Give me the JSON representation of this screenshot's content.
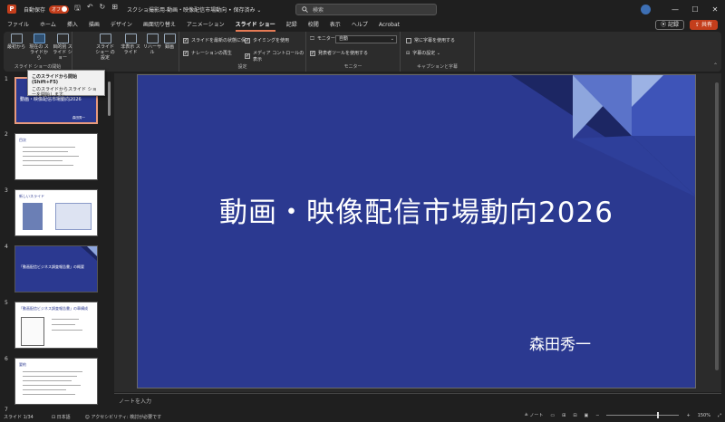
{
  "titlebar": {
    "logo": "P",
    "autosave_label": "自動保存",
    "autosave_state": "オフ",
    "doc_title": "スクショ撮影用-動画・映像配信市場動向 • 保存済み ⌄",
    "search_placeholder": "検索"
  },
  "tabs": [
    "ファイル",
    "ホーム",
    "挿入",
    "描画",
    "デザイン",
    "画面切り替え",
    "アニメーション",
    "スライド ショー",
    "記録",
    "校閲",
    "表示",
    "ヘルプ",
    "Acrobat"
  ],
  "active_tab": "スライド ショー",
  "ribbon_right": {
    "record_label": "記録",
    "share_label": "共有"
  },
  "ribbon": {
    "buttons": [
      "最初から",
      "現在の スライドから",
      "目的別 スライド ショー",
      "スライド ショー の設定",
      "非表示 スライド",
      "リハーサル",
      "録画"
    ],
    "group_start_label": "スライド ショーの開始",
    "group_setup_label": "設定",
    "group_monitor_label": "モニター",
    "group_caption_label": "キャプションと字幕",
    "checkboxes": [
      "スライドを最新の状態に保つ",
      "ナレーションの再生",
      "タイミングを使用",
      "メディア コントロールの表示",
      "発表者ツールを使用する",
      "常に字幕を使用する"
    ],
    "monitor_label": "モニター:",
    "monitor_value": "自動",
    "caption_settings": "字幕の設定 ⌄"
  },
  "tooltip": {
    "title": "このスライドから開始 (Shift+F5)",
    "body": "このスライドからスライド ショーを開始します。"
  },
  "thumbnails": [
    {
      "num": "1",
      "title": "動画・映像配信市場動向2026",
      "author": "森田秀一"
    },
    {
      "num": "2",
      "title": "目次"
    },
    {
      "num": "3",
      "title": "新しいスライド"
    },
    {
      "num": "4",
      "title": "「動画配信ビジネス調査報告書」の概要"
    },
    {
      "num": "5",
      "title": "「動画配信ビジネス調査報告書」の章構成"
    },
    {
      "num": "6",
      "title": "要約"
    },
    {
      "num": "7",
      "title": ""
    }
  ],
  "slide": {
    "title": "動画・映像配信市場動向2026",
    "subtitle": "森田秀一"
  },
  "notes_placeholder": "ノートを入力",
  "status": {
    "slide_counter": "スライド 1/34",
    "language": "日本語",
    "accessibility": "アクセシビリティ: 検討が必要です",
    "notes_label": "ノート",
    "zoom": "150%"
  },
  "colors": {
    "accent": "#c43e1c",
    "slide_bg": "#2b3990",
    "slide_decor_dark": "#1c2663",
    "slide_decor_light": "#8ea6dd",
    "selected_thumb_border": "#e89a7c"
  }
}
